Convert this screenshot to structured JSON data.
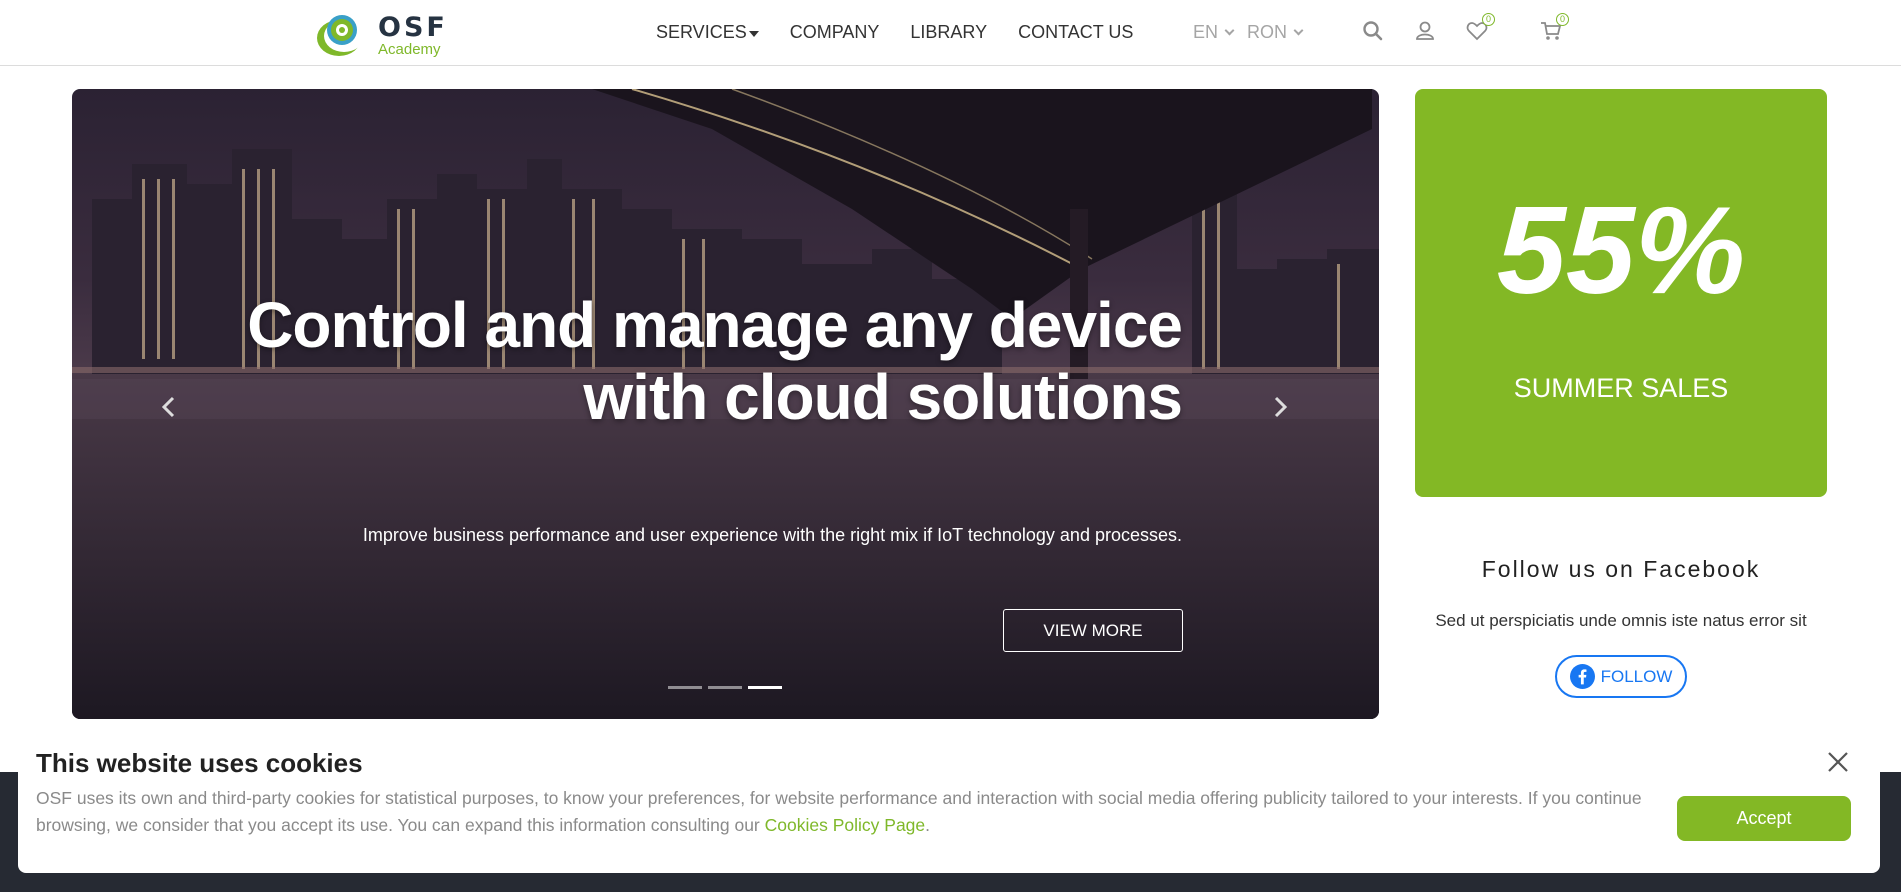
{
  "header": {
    "logo": {
      "brand": "OSF",
      "sub": "Academy"
    },
    "nav": [
      {
        "label": "SERVICES",
        "has_dropdown": true
      },
      {
        "label": "COMPANY"
      },
      {
        "label": "LIBRARY"
      },
      {
        "label": "CONTACT US"
      }
    ],
    "language": "EN",
    "currency": "RON",
    "wishlist_count": "0",
    "cart_count": "0",
    "icons": [
      "search-icon",
      "user-icon",
      "heart-icon",
      "cart-icon"
    ]
  },
  "hero": {
    "headline_line1": "Control and manage any device",
    "headline_line2": "with cloud solutions",
    "subline": "Improve business performance and user experience with the right mix if IoT technology and processes.",
    "cta_label": "VIEW MORE",
    "slide_count": 3,
    "active_slide": 3
  },
  "promo": {
    "percent": "55%",
    "label": "SUMMER SALES",
    "color": "#83b825"
  },
  "facebook": {
    "title": "Follow us on Facebook",
    "text": "Sed ut perspiciatis unde omnis iste natus error sit",
    "button_label": "FOLLOW",
    "color": "#1877f2"
  },
  "cookie_banner": {
    "title": "This website uses cookies",
    "text_part1": "OSF uses its own and third-party cookies for statistical purposes, to know your preferences, for website performance and interaction with social media offering publicity tailored to your interests. If you continue browsing, we consider that you accept its use. You can expand this information consulting our",
    "link_text": "Cookies Policy Page",
    "text_part2": ".",
    "accept_label": "Accept"
  },
  "colors": {
    "accent_green": "#83b825",
    "text_dark": "#333333"
  }
}
